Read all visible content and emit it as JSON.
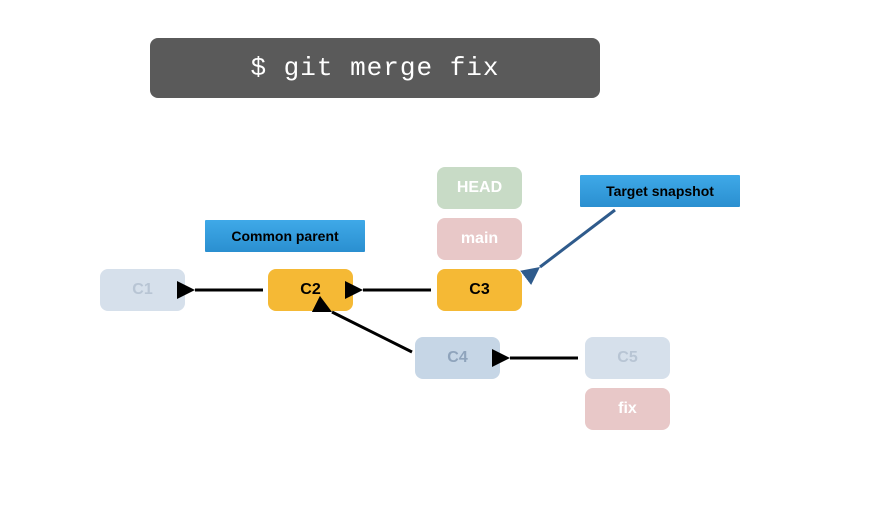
{
  "command": "$ git merge fix",
  "labels": {
    "common_parent": "Common  parent",
    "target_snapshot": "Target snapshot"
  },
  "refs": {
    "head": "HEAD",
    "main": "main",
    "fix": "fix"
  },
  "commits": {
    "c1": "C1",
    "c2": "C2",
    "c3": "C3",
    "c4": "C4",
    "c5": "C5"
  },
  "colors": {
    "command_bg": "#5a5a5a",
    "highlight": "#f5b935",
    "label_bg": "#3fa9e8",
    "faded_blue": "#d6e0eb",
    "green": "#c8dbc6",
    "red": "#e8c8c8"
  }
}
